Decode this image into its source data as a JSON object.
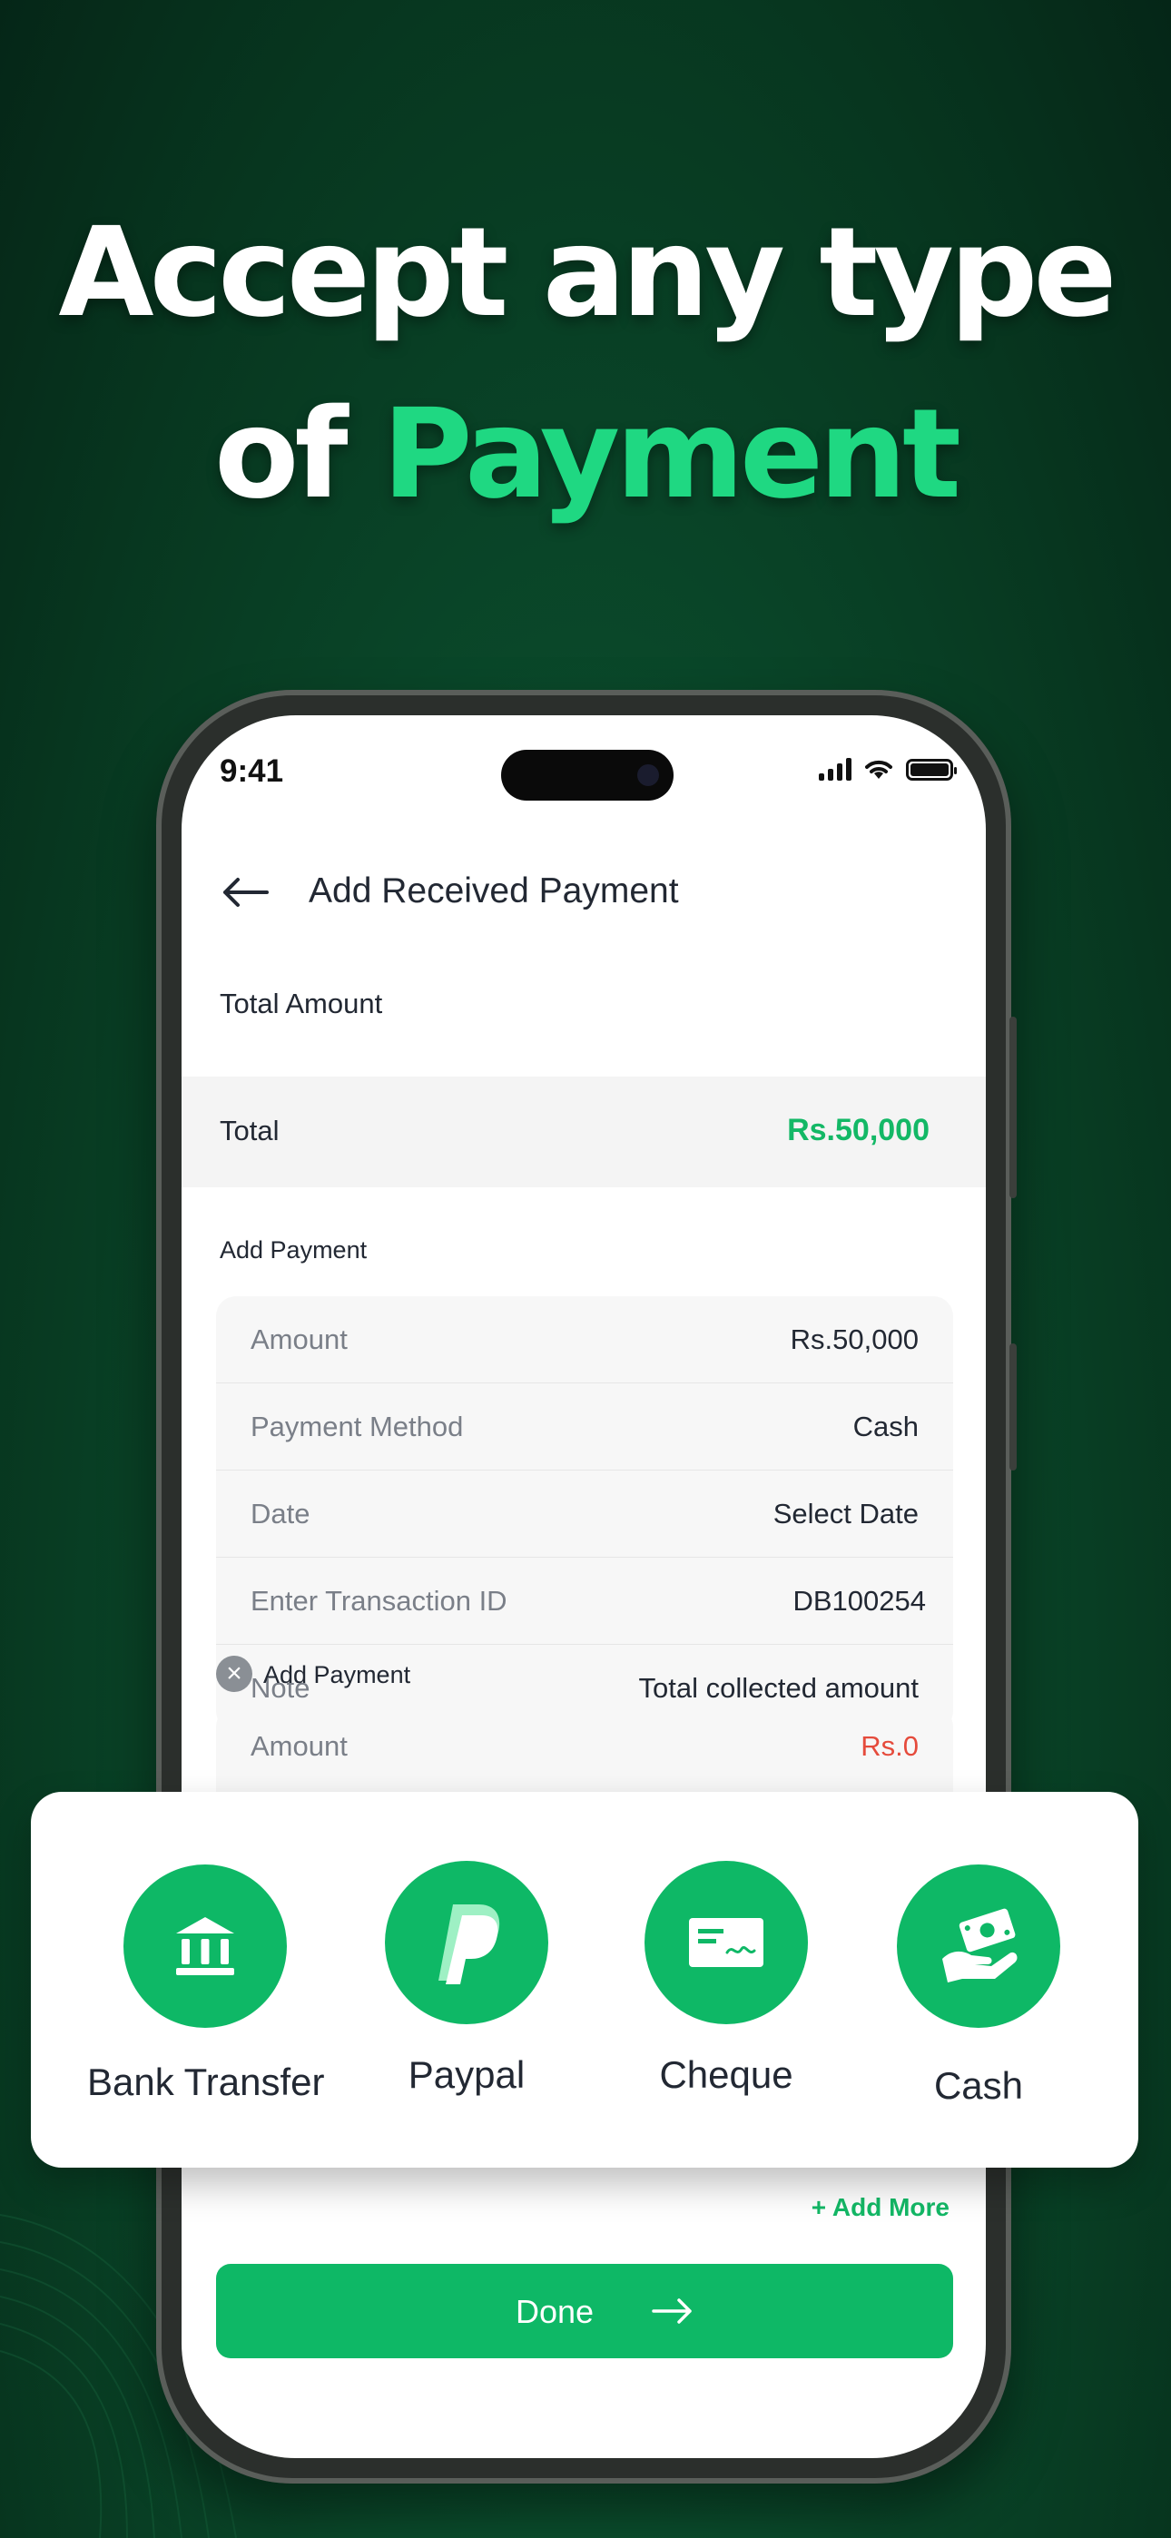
{
  "headline": {
    "line1": "Accept any type",
    "line2_prefix": "of",
    "line2_accent": "Payment"
  },
  "colors": {
    "brand_green": "#0eb866",
    "accent_green": "#1fd882",
    "amount_green": "#13b866",
    "negative_red": "#e54b3c",
    "background_dark": "#07361f"
  },
  "status_bar": {
    "time": "9:41",
    "icons": [
      "signal-icon",
      "wifi-icon",
      "battery-icon"
    ]
  },
  "header": {
    "back_icon": "arrow-left-icon",
    "title": "Add Received Payment"
  },
  "total_section": {
    "heading": "Total Amount",
    "label": "Total",
    "value": "Rs.50,000"
  },
  "payment_1": {
    "heading": "Add Payment",
    "rows": [
      {
        "key": "Amount",
        "value": "Rs.50,000"
      },
      {
        "key": "Payment Method",
        "value": "Cash"
      },
      {
        "key": "Date",
        "value": "Select Date"
      },
      {
        "key": "Enter Transaction ID",
        "value": "DB100254"
      },
      {
        "key": "Note",
        "value": "Total collected amount"
      }
    ]
  },
  "payment_2": {
    "heading": "Add Payment",
    "remove_icon": "close-circle-icon",
    "first_row": {
      "key": "Amount",
      "value": "Rs.0"
    }
  },
  "actions": {
    "add_more": "+ Add More",
    "done": "Done",
    "done_icon": "arrow-right-icon"
  },
  "payment_methods": [
    {
      "label": "Bank Transfer",
      "icon": "bank-icon"
    },
    {
      "label": "Paypal",
      "icon": "paypal-icon"
    },
    {
      "label": "Cheque",
      "icon": "cheque-icon"
    },
    {
      "label": "Cash",
      "icon": "cash-hand-icon"
    }
  ]
}
